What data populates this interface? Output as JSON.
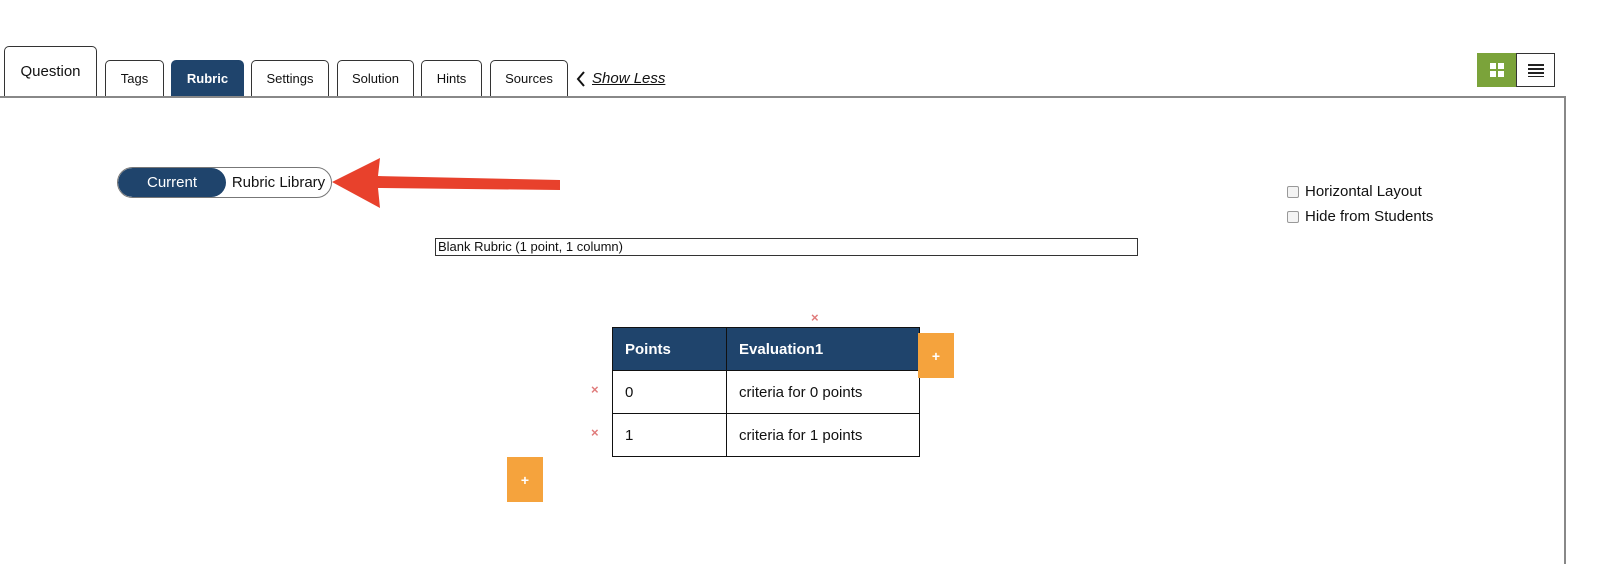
{
  "tabs": [
    {
      "label": "Question"
    },
    {
      "label": "Tags"
    },
    {
      "label": "Rubric"
    },
    {
      "label": "Settings"
    },
    {
      "label": "Solution"
    },
    {
      "label": "Hints"
    },
    {
      "label": "Sources"
    }
  ],
  "active_tab": "Rubric",
  "show_less": "Show Less",
  "view_toggle": {
    "selected": "grid-view",
    "options": [
      "grid-view",
      "list-view"
    ]
  },
  "rubric_source": {
    "current": "Current",
    "library": "Rubric Library"
  },
  "options": {
    "horizontal_layout": {
      "label": "Horizontal Layout",
      "checked": false
    },
    "hide_from_students": {
      "label": "Hide from Students",
      "checked": false
    }
  },
  "template_select": {
    "value": "Blank Rubric (1 point, 1 column)"
  },
  "rubric_table": {
    "headers": {
      "points": "Points",
      "evaluation": "Evaluation1"
    },
    "rows": [
      {
        "points": "0",
        "criteria": "criteria for 0 points"
      },
      {
        "points": "1",
        "criteria": "criteria for 1 points"
      }
    ]
  },
  "controls": {
    "remove_symbol": "×",
    "add_symbol": "+"
  },
  "colors": {
    "primary": "#1f446c",
    "accent_orange": "#f5a33d",
    "view_active_green": "#7ba33a",
    "remove_red": "#e07b7b",
    "annotation_arrow": "#e8412c"
  }
}
